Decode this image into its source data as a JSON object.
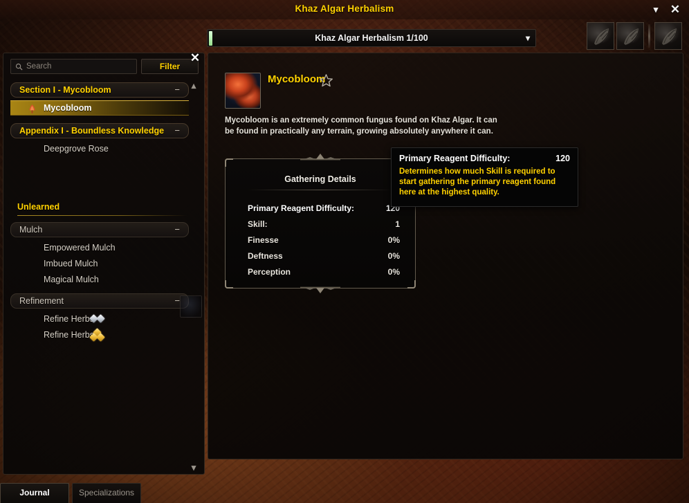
{
  "window": {
    "title": "Khaz Algar Herbalism",
    "minimize_icon": "chevron-down-icon",
    "close_icon": "close-icon"
  },
  "skill_line": {
    "label": "Khaz Algar Herbalism 1/100",
    "current": 1,
    "max": 100,
    "chevron": "⌄"
  },
  "reagent_slots": [
    {
      "name": "reagent-slot-1",
      "icon": "feather-icon"
    },
    {
      "name": "reagent-slot-2",
      "icon": "feather-icon"
    },
    {
      "name": "reagent-slot-3",
      "icon": "feather-icon"
    }
  ],
  "sidebar": {
    "close_icon": "close-icon",
    "search": {
      "placeholder": "Search",
      "value": "",
      "icon": "search-icon"
    },
    "filter_label": "Filter",
    "scroll_up_icon": "˄",
    "scroll_down_icon": "˅",
    "learned": [
      {
        "type": "category",
        "label": "Section I - Mycobloom",
        "toggle": "−",
        "highlight": true,
        "items": [
          {
            "label": "Mycobloom",
            "selected": true,
            "icon": "mushroom-icon"
          }
        ]
      },
      {
        "type": "category",
        "label": "Appendix I - Boundless Knowledge",
        "toggle": "−",
        "highlight": true,
        "items": [
          {
            "label": "Deepgrove Rose",
            "selected": false,
            "icon": ""
          }
        ]
      }
    ],
    "unlearned_header": "Unlearned",
    "unlearned": [
      {
        "type": "category",
        "label": "Mulch",
        "toggle": "−",
        "highlight": false,
        "items": [
          {
            "label": "Empowered Mulch",
            "selected": false,
            "icon": ""
          },
          {
            "label": "Imbued Mulch",
            "selected": false,
            "icon": ""
          },
          {
            "label": "Magical Mulch",
            "selected": false,
            "icon": ""
          }
        ]
      },
      {
        "type": "category",
        "label": "Refinement",
        "toggle": "−",
        "highlight": false,
        "items": [
          {
            "label": "Refine Herbs -",
            "selected": false,
            "icon": "",
            "quality": 2
          },
          {
            "label": "Refine Herbs -",
            "selected": false,
            "icon": "",
            "quality": 3
          }
        ]
      }
    ]
  },
  "recipe": {
    "icon": "mycobloom-icon",
    "name": "Mycobloom",
    "favorite_icon": "star-icon",
    "favorite_active": false,
    "description": "Mycobloom is an extremely common fungus found on Khaz Algar. It can be found in practically any terrain, growing absolutely anywhere it can."
  },
  "details": {
    "title": "Gathering Details",
    "stats": [
      {
        "label": "Primary Reagent Difficulty:",
        "value": "120",
        "hovered": true
      },
      {
        "label": "Skill:",
        "value": "1",
        "hovered": false
      },
      {
        "label": "Finesse",
        "value": "0%",
        "hovered": false
      },
      {
        "label": "Deftness",
        "value": "0%",
        "hovered": false
      },
      {
        "label": "Perception",
        "value": "0%",
        "hovered": false
      }
    ]
  },
  "tooltip": {
    "title": "Primary Reagent Difficulty:",
    "value": "120",
    "body": "Determines how much Skill is required to start gathering the primary reagent found here at the highest quality."
  },
  "tabs": [
    {
      "label": "Journal",
      "active": true
    },
    {
      "label": "Specializations",
      "active": false
    }
  ],
  "colors": {
    "gold": "#ffd100",
    "text": "#e8e4dc",
    "tooltip_body": "#ffd100"
  }
}
